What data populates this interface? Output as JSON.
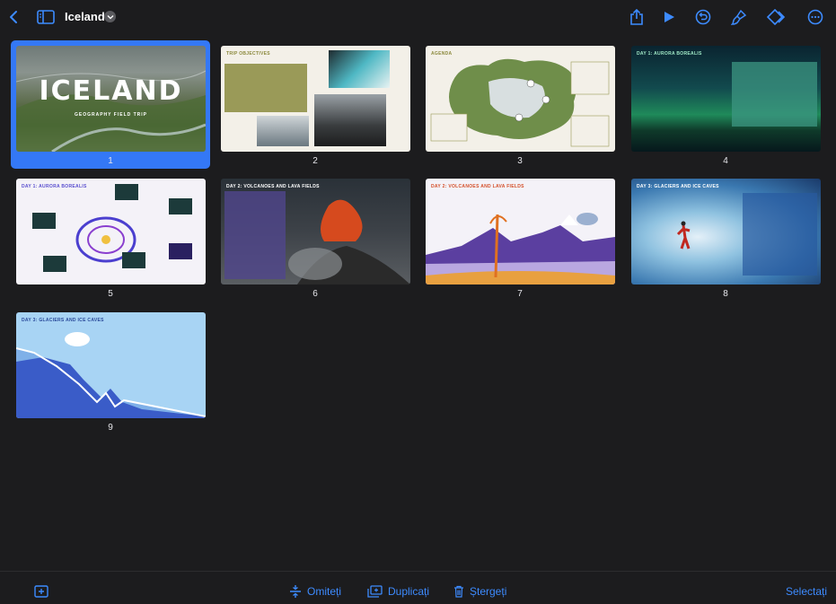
{
  "header": {
    "title": "Iceland"
  },
  "slides": [
    {
      "number": "1",
      "title": "ICELAND",
      "subtitle": "GEOGRAPHY FIELD TRIP"
    },
    {
      "number": "2",
      "title": "TRIP OBJECTIVES"
    },
    {
      "number": "3",
      "title": "AGENDA"
    },
    {
      "number": "4",
      "title": "DAY 1: AURORA BOREALIS"
    },
    {
      "number": "5",
      "title": "DAY 1: AURORA BOREALIS"
    },
    {
      "number": "6",
      "title": "DAY 2: VOLCANOES AND LAVA FIELDS"
    },
    {
      "number": "7",
      "title": "DAY 2: VOLCANOES AND LAVA FIELDS"
    },
    {
      "number": "8",
      "title": "DAY 3: GLACIERS AND ICE CAVES"
    },
    {
      "number": "9",
      "title": "DAY 3: GLACIERS AND ICE CAVES"
    }
  ],
  "bottombar": {
    "skip_label": "Omiteți",
    "duplicate_label": "Duplicați",
    "delete_label": "Ștergeți",
    "select_label": "Selectați"
  },
  "colors": {
    "accent": "#3d8bff",
    "selection": "#3478f6",
    "background": "#1c1c1e"
  }
}
